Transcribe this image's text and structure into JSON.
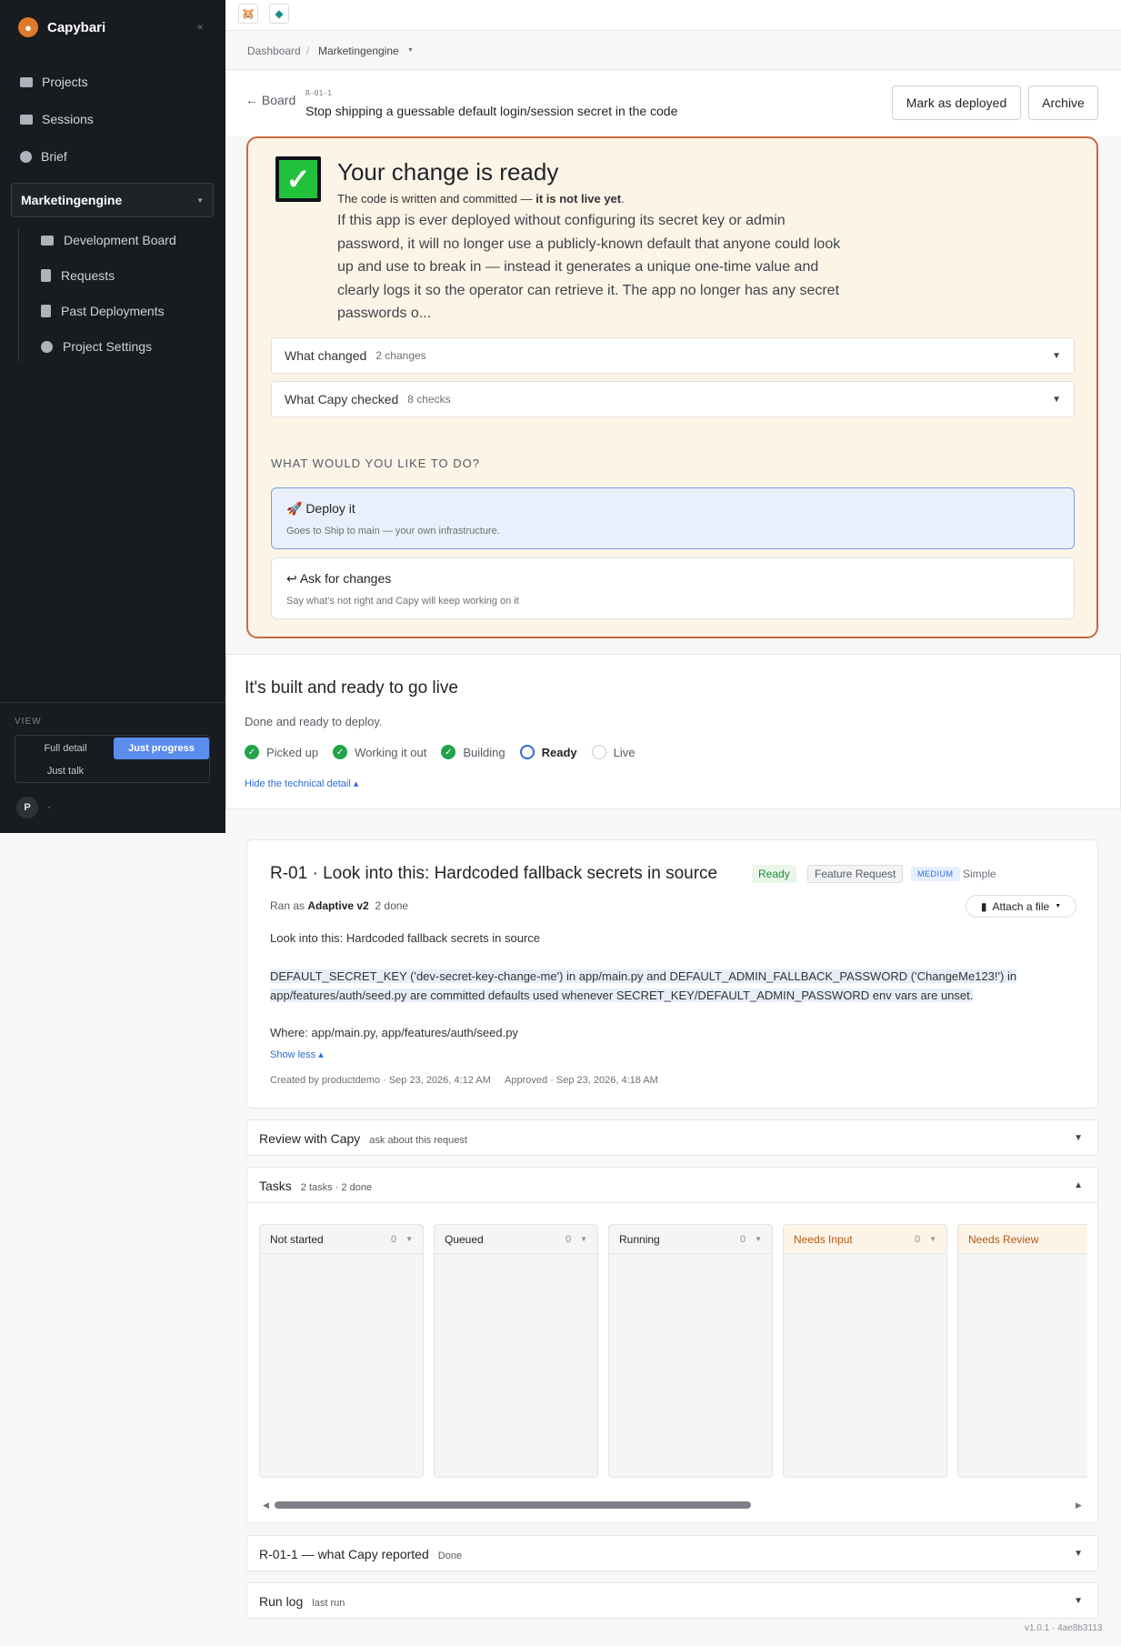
{
  "sidebar": {
    "brand": "Capybari",
    "collapse_icon": "«",
    "nav": [
      {
        "label": "Projects",
        "icon": "folder-icon"
      },
      {
        "label": "Sessions",
        "icon": "chat-icon"
      },
      {
        "label": "Brief",
        "icon": "sparkle-icon"
      }
    ],
    "project": "Marketingengine",
    "project_items": [
      {
        "label": "Development Board",
        "icon": "folder-icon"
      },
      {
        "label": "Requests",
        "icon": "clipboard-icon"
      },
      {
        "label": "Past Deployments",
        "icon": "document-icon"
      },
      {
        "label": "Project Settings",
        "icon": "gear-icon"
      }
    ],
    "view_label": "VIEW",
    "view_options": [
      "Full detail",
      "Just progress",
      "Just talk"
    ],
    "view_selected": "Just progress",
    "user_initial": "P",
    "user_name": "·"
  },
  "breadcrumb": {
    "root": "Dashboard",
    "sep": "/",
    "current": "Marketingengine"
  },
  "header": {
    "back_label": "← Board",
    "request_id": "R-01-1",
    "title": "Stop shipping a guessable default login/session secret in the code",
    "mark_deployed": "Mark as deployed",
    "archive": "Archive"
  },
  "ready": {
    "title": "Your change is ready",
    "subtitle_prefix": "The code is written and committed — ",
    "subtitle_bold": "it is not live yet",
    "subtitle_suffix": ".",
    "description": "If this app is ever deployed without configuring its secret key or admin password, it will no longer use a publicly-known default that anyone could look up and use to break in — instead it generates a unique one-time value and clearly logs it so the operator can retrieve it. The app no longer has any secret passwords o...",
    "changed_label": "What changed",
    "changed_count": "2 changes",
    "checked_label": "What Capy checked",
    "checked_count": "8 checks",
    "ask_label": "WHAT WOULD YOU LIKE TO DO?",
    "deploy_title": "🚀 Deploy it",
    "deploy_sub": "Goes to Ship to main — your own infrastructure.",
    "changes_title": "↩ Ask for changes",
    "changes_sub": "Say what's not right and Capy will keep working on it"
  },
  "status": {
    "title": "It's built and ready to go live",
    "subtitle": "Done and ready to deploy.",
    "steps": [
      {
        "label": "Picked up",
        "state": "done"
      },
      {
        "label": "Working it out",
        "state": "done"
      },
      {
        "label": "Building",
        "state": "done"
      },
      {
        "label": "Ready",
        "state": "current"
      },
      {
        "label": "Live",
        "state": "todo"
      }
    ],
    "hide_link": "Hide the technical detail ▴"
  },
  "request": {
    "title": "R-01 · Look into this: Hardcoded fallback secrets in source",
    "status": "Ready",
    "type": "Feature Request",
    "priority": "MEDIUM",
    "complexity": "Simple",
    "ran_as_prefix": "Ran as ",
    "ran_as_agent": "Adaptive v2",
    "done_count": "2 done",
    "attach": "Attach a file",
    "lead": "Look into this: Hardcoded fallback secrets in source",
    "detail_line1": "DEFAULT_SECRET_KEY ('dev-secret-key-change-me') in app/main.py and DEFAULT_ADMIN_FALLBACK_PASSWORD ('ChangeMe123!') in",
    "detail_line2": "app/features/auth/seed.py are committed defaults used whenever SECRET_KEY/DEFAULT_ADMIN_PASSWORD env vars are unset.",
    "where": "Where: app/main.py, app/features/auth/seed.py",
    "show_less": "Show less ▴",
    "created": "Created by productdemo · Sep 23, 2026, 4:12 AM",
    "approved": "Approved · Sep 23, 2026, 4:18 AM"
  },
  "review": {
    "title": "Review with Capy",
    "sub": "ask about this request"
  },
  "tasks": {
    "title": "Tasks",
    "sub": "2 tasks · 2 done",
    "columns": [
      {
        "label": "Not started",
        "count": "0"
      },
      {
        "label": "Queued",
        "count": "0"
      },
      {
        "label": "Running",
        "count": "0"
      },
      {
        "label": "Needs Input",
        "count": "0"
      },
      {
        "label": "Needs Review",
        "count": ""
      }
    ]
  },
  "report": {
    "title": "R-01-1 — what Capy reported",
    "sub": "Done"
  },
  "runlog": {
    "title": "Run log",
    "sub": "last run"
  },
  "version": "v1.0.1 · 4ae8b3113"
}
